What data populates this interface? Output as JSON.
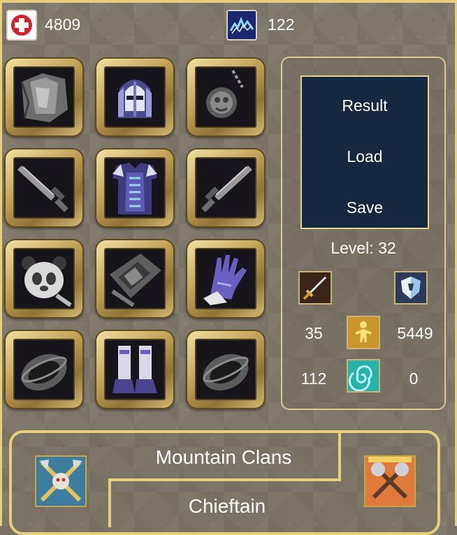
{
  "resources": {
    "health": {
      "icon": "health-cross-icon",
      "value": "4809"
    },
    "mana": {
      "icon": "lightning-icon",
      "value": "122"
    }
  },
  "equipment_slots": [
    {
      "item": "cloak-icon"
    },
    {
      "item": "helmet-icon"
    },
    {
      "item": "amulet-icon"
    },
    {
      "item": "sword-icon"
    },
    {
      "item": "chest-armor-icon"
    },
    {
      "item": "sword-icon"
    },
    {
      "item": "panda-trinket-icon"
    },
    {
      "item": "belt-icon"
    },
    {
      "item": "glove-icon"
    },
    {
      "item": "ring-icon"
    },
    {
      "item": "boots-icon"
    },
    {
      "item": "ring-icon"
    }
  ],
  "menu": {
    "result": "Result",
    "load": "Load",
    "save": "Save"
  },
  "level": {
    "text": "Level: 32"
  },
  "stats": {
    "attack_icon": "sword-stat-icon",
    "defense_icon": "shield-stat-icon",
    "character_icon": "figure-icon",
    "swirl_icon": "swirl-icon",
    "left_top": "35",
    "right_top": "5449",
    "left_bottom": "112",
    "right_bottom": "0"
  },
  "banner": {
    "faction": "Mountain Clans",
    "title": "Chieftain",
    "left_emblem": "crossed-axes-skull-icon",
    "right_emblem": "crossed-hammers-icon"
  },
  "colors": {
    "gold": "#e6cf7d",
    "menu_bg": "#162740",
    "panel_border": "#d8c98a"
  }
}
